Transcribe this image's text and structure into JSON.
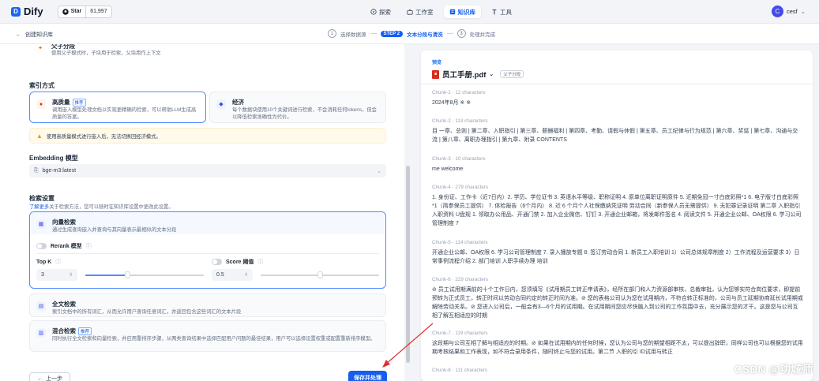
{
  "app": {
    "logo": "Dify",
    "logo_mark": "D",
    "github_label": "Star",
    "github_count": "61,997",
    "nav": [
      {
        "label": "探索"
      },
      {
        "label": "工作室"
      },
      {
        "label": "知识库"
      },
      {
        "label": "工具"
      }
    ],
    "user_initial": "C",
    "user_name": "cesf"
  },
  "stepbar": {
    "back_label": "创建知识库",
    "steps": [
      {
        "num": "1",
        "label": "选择数据源"
      },
      {
        "num": "STEP 2",
        "label": "文本分段与清洗"
      },
      {
        "num": "3",
        "label": "处理并完成"
      }
    ]
  },
  "left": {
    "parent_child": {
      "title": "父子分段",
      "desc": "使用父子模式时，子块用于检索，父块用作上下文"
    },
    "index_title": "索引方式",
    "high_quality": {
      "title": "高质量",
      "badge": "推荐",
      "desc": "调用嵌入模型处理文档以实现更精确的检索，可以帮助LLM生成高质量的答案。"
    },
    "economy": {
      "title": "经济",
      "desc": "每个数据块使用10个关键词进行检索，不会消耗任何tokens，但会以降低检索准确性为代价。"
    },
    "warning": "使用高质量模式进行嵌入后，无法切换回经济模式。",
    "embedding_title": "Embedding 模型",
    "embedding_value": "bge-m3:latest",
    "retrieval_title": "检索设置",
    "retrieval_desc_link": "了解更多",
    "retrieval_desc": "关于检索方法，您可以随时在知识库设置中更改此设置。",
    "vector": {
      "title": "向量检索",
      "desc": "通过生成查询嵌入并查询与其向量表示最相似的文本分段"
    },
    "rerank_label": "Rerank 模型",
    "topk_label": "Top K",
    "topk_value": "3",
    "topk_level": 0.35,
    "score_label": "Score 阈值",
    "score_value": "0.5",
    "score_level": 0.5,
    "fulltext": {
      "title": "全文检索",
      "desc": "索引文档中的所有词汇，从而允许用户查询任意词汇，并返回包含这些词汇的文本片段"
    },
    "hybrid": {
      "title": "混合检索",
      "badge": "推荐",
      "desc": "同时执行全文检索和向量检索，并应用重排序步骤，从两类查询结果中选择匹配用户问题的最佳结果，用户可以选择设置权重或配置重新排序模型。"
    },
    "prev_label": "上一步",
    "save_label": "保存并处理"
  },
  "preview": {
    "label": "预览",
    "file_name": "员工手册.pdf",
    "file_badge": "父子分段",
    "chunks": [
      {
        "header": "Chunk-1 · 12 characters",
        "text": "2024年8月 ※ ※"
      },
      {
        "header": "Chunk-2 · 113 characters",
        "text": "目 一章、总则 | 第二章、入职指引 | 第三章、薪酬福利 | 第四章、考勤、请假与休假 | 第五章、员工纪律与行为规范 | 第六章、奖惩 | 第七章、沟通与交流 | 第八章、离职办理指引 | 第九章、附录 CONTENTS"
      },
      {
        "header": "Chunk-3 · 10 characters",
        "text": "me welcome"
      },
      {
        "header": "Chunk-4 · 279 characters",
        "text": "1. 身份证、工作卡（近7日内）2. 学历、学位证书 3. 英语水平等级、职称证明 4. 原单位离职证明原件 5. 近期免冠一寸白底彩照*1 6. 电子版寸白底彩照*1（简参保员工提供） 7. 体检报告（6个月内） 8. 近 6 个月个人社保缴纳凭证明 劳动合同（新参保人员无需提供） 9. 无犯罪记录证明 第二章 入职指引 入职资料 U盘规 1. 领取办公用品、开通门禁 2. 加入企业微信、钉钉 3. 开通企业邮箱，将发邮件签名 4. 阅读文件 5. 开通企业公邮、OA权限 6. 学习公司管理制度 7"
      },
      {
        "header": "Chunk-5 · 114 characters",
        "text": "开通企业公邮、OA权限 6. 学习公司管理制度 7. 录入播放专题 8. 签订劳动合同 1. 新员工入职培训 1）公司总体规章制度 2）工作流程及运营要求 3）日常事例流程介绍 2. 部门培训 入职手续办理 培训"
      },
      {
        "header": "Chunk-6 · 229 characters",
        "text": "⊘ 员工试用期满前的十个工作日内，您须填写《试用期员工转正申请表》，经所在部门和人力资源部审核，总裁审批，认为您够实符合岗位要求，即提前预转为正式员工，转正时间以劳动合同约定的转正时间为准。⊘ 您的表格公司认为您在试用期内，不符合转正标准的，公司与员工延期协商延长试用期或解除劳动关系。⊘ 您进入公司后，一般会有3—6个月的试用期。在试用期间您应尽快融入到公司的工作氛围中去，充分展示您的才干。这是您与公司互相了解互相适应的时期"
      },
      {
        "header": "Chunk-7 · 119 characters",
        "text": "这段期与公司互相了解与相适应的时期。⊘ 如果在试用期内的任何时候，您认为公司与您的期望相距不太，可以提出辞职，同样公司也可以根据您的试用期考核结果和工作表现，如不符合录用条件，随时终止与您的试用。第二节 入职的引 ID试用与转正"
      },
      {
        "header": "Chunk-8 · 111 characters",
        "text": ""
      }
    ]
  },
  "watermark": "CSDN @功城师"
}
